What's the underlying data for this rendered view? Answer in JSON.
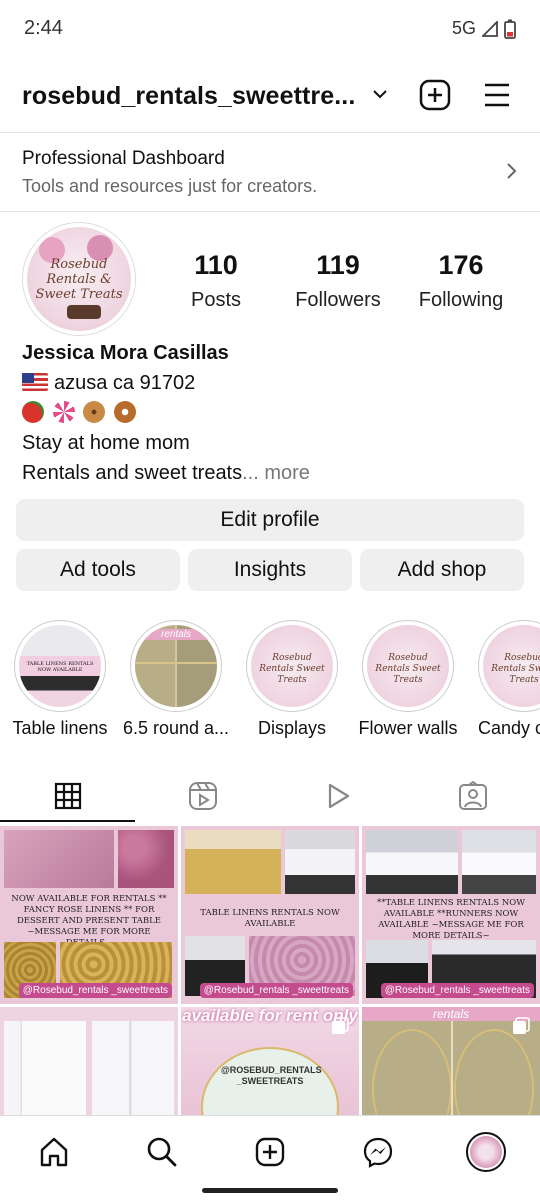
{
  "status_bar": {
    "time": "2:44",
    "network": "5G"
  },
  "header": {
    "username": "rosebud_rentals_sweettre..."
  },
  "dashboard": {
    "title": "Professional Dashboard",
    "subtitle": "Tools and resources just for creators."
  },
  "profile": {
    "avatar_text": "Rosebud Rentals & Sweet Treats",
    "stats": [
      {
        "num": "110",
        "label": "Posts"
      },
      {
        "num": "119",
        "label": "Followers"
      },
      {
        "num": "176",
        "label": "Following"
      }
    ],
    "name": "Jessica Mora Casillas",
    "location": "azusa ca 91702",
    "bio_line1": "Stay at home mom",
    "bio_line2": "Rentals and sweet treats",
    "more": "... more"
  },
  "buttons": {
    "edit_profile": "Edit profile",
    "ad_tools": "Ad tools",
    "insights": "Insights",
    "add_shop": "Add shop"
  },
  "highlights": [
    {
      "label": "Table linens",
      "pic_text": "TABLE LINENS RENTALS NOW AVAILABLE"
    },
    {
      "label": "6.5 round a...",
      "pic_text": "rentals"
    },
    {
      "label": "Displays",
      "pic_text": "Rosebud Rentals Sweet Treats"
    },
    {
      "label": "Flower walls",
      "pic_text": "Rosebud Rentals Sweet Treats"
    },
    {
      "label": "Candy c",
      "pic_text": "Rosebud Rentals Sweet Treats"
    }
  ],
  "posts": [
    {
      "caption": "NOW AVAILABLE FOR RENTALS ** FANCY ROSE LINENS ** FOR DESSERT AND PRESENT TABLE ~MESSAGE ME FOR MORE DETAILS~",
      "handle": "@Rosebud_rentals _sweettreats"
    },
    {
      "caption": "TABLE LINENS RENTALS NOW AVAILABLE",
      "handle": "@Rosebud_rentals _sweettreats"
    },
    {
      "caption": "**TABLE LINENS RENTALS NOW AVAILABLE **RUNNERS NOW AVAILABLE ~MESSAGE ME FOR MORE DETAILS~",
      "handle": "@Rosebud_rentals _sweettreats"
    },
    {
      "caption": "",
      "handle": ""
    },
    {
      "caption": "available for rent only",
      "handle": "@ROSEBUD_RENTALS _SWEETREATS"
    },
    {
      "caption": "rentals",
      "handle": ""
    }
  ],
  "colors": {
    "accent_pink": "#e7b6cc",
    "button_bg": "#efefef",
    "gold": "#c9a24a"
  }
}
